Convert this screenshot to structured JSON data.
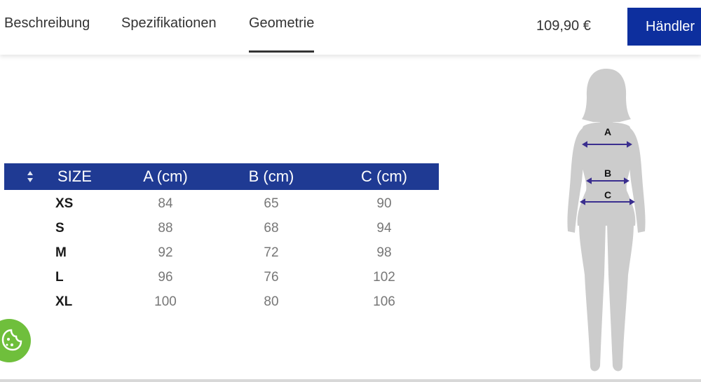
{
  "tabs": [
    {
      "label": "Beschreibung"
    },
    {
      "label": "Spezifikationen"
    },
    {
      "label": "Geometrie",
      "active": true
    }
  ],
  "price": "109,90 €",
  "dealer_button": "Händler",
  "size_table": {
    "headers": [
      "SIZE",
      "A (cm)",
      "B (cm)",
      "C (cm)"
    ],
    "rows": [
      {
        "size": "XS",
        "a": "84",
        "b": "65",
        "c": "90"
      },
      {
        "size": "S",
        "a": "88",
        "b": "68",
        "c": "94"
      },
      {
        "size": "M",
        "a": "92",
        "b": "72",
        "c": "98"
      },
      {
        "size": "L",
        "a": "96",
        "b": "76",
        "c": "102"
      },
      {
        "size": "XL",
        "a": "100",
        "b": "80",
        "c": "106"
      }
    ]
  },
  "figure": {
    "labels": [
      "A",
      "B",
      "C"
    ]
  },
  "colors": {
    "header_bg": "#1f3a93",
    "button_bg": "#0d2f9e",
    "cookie_bg": "#6fbf3c",
    "silhouette": "#cccccc",
    "measure_line": "#3b2f8f"
  },
  "icons": {
    "sort": "sort-icon",
    "cookie": "cookie-icon"
  }
}
